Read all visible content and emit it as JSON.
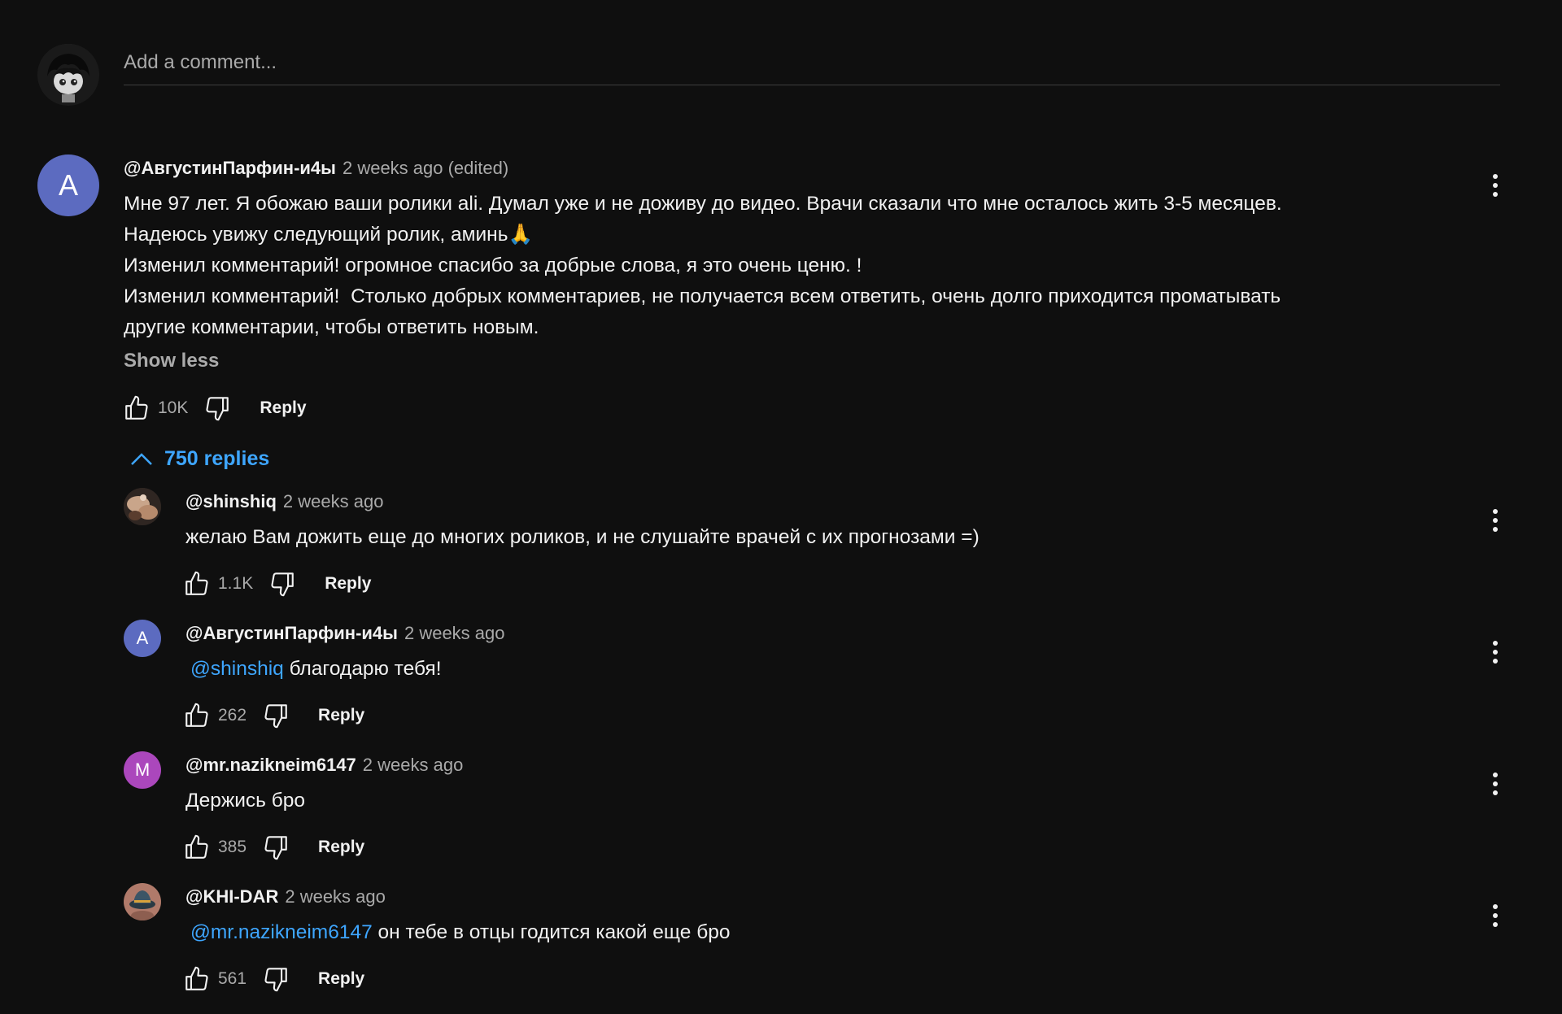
{
  "add_comment": {
    "placeholder": "Add a comment..."
  },
  "main_comment": {
    "avatar_letter": "A",
    "avatar_color": "#5c6bc0",
    "author": "@АвгустинПарфин-и4ы",
    "time": "2 weeks ago (edited)",
    "lines": [
      "Мне 97 лет. Я обожаю ваши ролики ali. Думал уже и не доживу до видео. Врачи сказали что мне осталось жить 3-5 месяцев.",
      "Надеюсь увижу следующий ролик, аминь🙏",
      "Изменил комментарий! огромное спасибо за добрые слова, я это очень ценю. !",
      "Изменил комментарий!  Столько добрых комментариев, не получается всем ответить, очень долго приходится проматывать",
      "другие комментарии, чтобы ответить новым."
    ],
    "show_less": "Show less",
    "likes": "10K",
    "reply_label": "Reply"
  },
  "replies_toggle": {
    "label": "750 replies"
  },
  "replies": [
    {
      "author": "@shinshiq",
      "time": "2 weeks ago",
      "mention": "",
      "text": "желаю Вам дожить еще до многих роликов, и не слушайте врачей с их прогнозами =)",
      "likes": "1.1K",
      "reply_label": "Reply",
      "avatar_type": "photo-hands"
    },
    {
      "author": "@АвгустинПарфин-и4ы",
      "time": "2 weeks ago",
      "mention": "@shinshiq",
      "text": "благодарю тебя!",
      "likes": "262",
      "reply_label": "Reply",
      "avatar_letter": "A",
      "avatar_color": "#5c6bc0"
    },
    {
      "author": "@mr.nazikneim6147",
      "time": "2 weeks ago",
      "mention": "",
      "text": "Держись бро",
      "likes": "385",
      "reply_label": "Reply",
      "avatar_letter": "M",
      "avatar_color": "#ab47bc"
    },
    {
      "author": "@KHI-DAR",
      "time": "2 weeks ago",
      "mention": "@mr.nazikneim6147",
      "text": "он тебе в отцы годится какой еще бро",
      "likes": "561",
      "reply_label": "Reply",
      "avatar_type": "photo-hat"
    }
  ]
}
